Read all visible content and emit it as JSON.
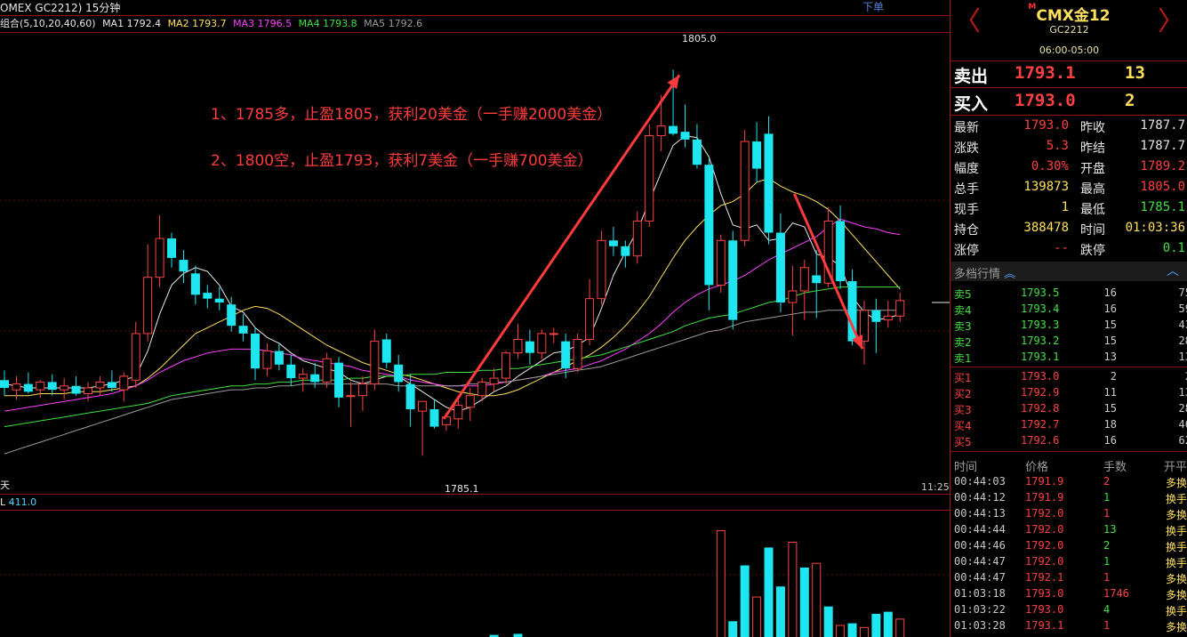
{
  "header": {
    "symbol": "OMEX GC2212) 15分钟",
    "order_button": "下单",
    "ma_group": "组合(5,10,20,40,60)",
    "ma": [
      {
        "label": "MA1 1792.4",
        "color": "#e8e8e8"
      },
      {
        "label": "MA2 1793.7",
        "color": "#ffe05a"
      },
      {
        "label": "MA3 1796.5",
        "color": "#ff40ff"
      },
      {
        "label": "MA4 1793.8",
        "color": "#40e040"
      },
      {
        "label": "MA5 1792.6",
        "color": "#9a9a9a"
      }
    ]
  },
  "annotations": {
    "line1": "1、1785多，止盈1805，获利20美金（一手赚2000美金）",
    "line2": "2、1800空，止盈1793，获利7美金（一手赚700美金）"
  },
  "chart_labels": {
    "high": "1805.0",
    "low": "1785.1",
    "left_marker": "天",
    "time_right": "11:25"
  },
  "volume_header": {
    "prefix": "L",
    "value": "411.0"
  },
  "chart_data": {
    "type": "candlestick",
    "ylim": [
      1783.6,
      1806.3
    ],
    "candles": [
      [
        1789.0,
        1789.5,
        1788.2,
        1788.6
      ],
      [
        1788.5,
        1789.2,
        1788.0,
        1788.8
      ],
      [
        1788.8,
        1789.4,
        1788.3,
        1788.4
      ],
      [
        1788.5,
        1789.0,
        1788.1,
        1788.9
      ],
      [
        1788.9,
        1789.3,
        1788.2,
        1788.5
      ],
      [
        1788.5,
        1789.1,
        1788.0,
        1788.7
      ],
      [
        1788.7,
        1789.2,
        1788.2,
        1788.3
      ],
      [
        1788.3,
        1788.9,
        1787.9,
        1788.6
      ],
      [
        1788.6,
        1789.2,
        1788.2,
        1788.9
      ],
      [
        1788.9,
        1789.5,
        1788.4,
        1788.6
      ],
      [
        1788.5,
        1789.4,
        1787.9,
        1789.2
      ],
      [
        1789.0,
        1792.0,
        1788.6,
        1791.4
      ],
      [
        1791.4,
        1796.0,
        1791.0,
        1794.3
      ],
      [
        1794.3,
        1797.5,
        1793.8,
        1796.3
      ],
      [
        1796.3,
        1796.6,
        1794.8,
        1795.3
      ],
      [
        1795.2,
        1795.7,
        1794.0,
        1794.6
      ],
      [
        1794.5,
        1794.9,
        1792.9,
        1793.4
      ],
      [
        1793.5,
        1793.9,
        1792.7,
        1793.2
      ],
      [
        1793.2,
        1793.8,
        1792.6,
        1793.0
      ],
      [
        1792.9,
        1793.3,
        1791.5,
        1791.8
      ],
      [
        1791.8,
        1792.4,
        1791.0,
        1791.4
      ],
      [
        1791.4,
        1791.7,
        1789.0,
        1789.6
      ],
      [
        1789.6,
        1790.9,
        1789.2,
        1790.5
      ],
      [
        1790.5,
        1790.9,
        1789.5,
        1789.8
      ],
      [
        1789.8,
        1790.3,
        1788.7,
        1789.1
      ],
      [
        1789.1,
        1789.6,
        1788.4,
        1789.3
      ],
      [
        1789.3,
        1789.9,
        1788.6,
        1788.9
      ],
      [
        1788.9,
        1790.4,
        1788.6,
        1790.1
      ],
      [
        1789.9,
        1790.2,
        1787.6,
        1788.1
      ],
      [
        1788.2,
        1788.9,
        1786.6,
        1788.2
      ],
      [
        1788.2,
        1789.2,
        1787.4,
        1788.8
      ],
      [
        1788.8,
        1791.6,
        1788.5,
        1791.0
      ],
      [
        1791.1,
        1791.4,
        1789.6,
        1789.9
      ],
      [
        1789.8,
        1790.3,
        1788.4,
        1788.9
      ],
      [
        1788.8,
        1789.3,
        1786.6,
        1787.5
      ],
      [
        1787.4,
        1787.9,
        1785.1,
        1787.9
      ],
      [
        1787.5,
        1788.0,
        1786.5,
        1786.6
      ],
      [
        1786.7,
        1787.3,
        1786.4,
        1787.1
      ],
      [
        1787.0,
        1788.0,
        1786.5,
        1787.7
      ],
      [
        1787.6,
        1788.6,
        1786.9,
        1788.2
      ],
      [
        1788.2,
        1789.1,
        1787.9,
        1788.9
      ],
      [
        1788.8,
        1789.6,
        1788.4,
        1789.1
      ],
      [
        1789.1,
        1790.5,
        1788.8,
        1790.4
      ],
      [
        1790.4,
        1791.9,
        1790.1,
        1791.1
      ],
      [
        1791.0,
        1791.6,
        1789.8,
        1790.4
      ],
      [
        1790.4,
        1791.6,
        1790.1,
        1791.4
      ],
      [
        1791.4,
        1791.7,
        1790.9,
        1791.4
      ],
      [
        1791.0,
        1791.4,
        1789.1,
        1789.6
      ],
      [
        1789.6,
        1791.4,
        1789.4,
        1791.1
      ],
      [
        1791.1,
        1794.2,
        1790.8,
        1793.2
      ],
      [
        1793.2,
        1796.7,
        1792.9,
        1796.2
      ],
      [
        1796.2,
        1796.9,
        1795.4,
        1795.9
      ],
      [
        1795.9,
        1796.2,
        1794.8,
        1795.4
      ],
      [
        1795.4,
        1797.7,
        1795.0,
        1797.2
      ],
      [
        1797.2,
        1802.2,
        1796.9,
        1801.6
      ],
      [
        1801.6,
        1803.7,
        1800.8,
        1802.1
      ],
      [
        1802.1,
        1805.0,
        1801.6,
        1801.7
      ],
      [
        1801.8,
        1803.2,
        1801.0,
        1801.4
      ],
      [
        1801.4,
        1802.2,
        1799.9,
        1800.1
      ],
      [
        1800.1,
        1800.4,
        1792.6,
        1793.9
      ],
      [
        1793.9,
        1796.5,
        1793.5,
        1796.2
      ],
      [
        1796.2,
        1796.7,
        1791.6,
        1792.1
      ],
      [
        1796.2,
        1801.9,
        1795.9,
        1801.3
      ],
      [
        1801.3,
        1802.3,
        1799.2,
        1799.9
      ],
      [
        1801.7,
        1802.6,
        1796.0,
        1796.6
      ],
      [
        1796.6,
        1797.6,
        1792.5,
        1793.0
      ],
      [
        1793.0,
        1794.9,
        1791.3,
        1793.6
      ],
      [
        1793.6,
        1795.2,
        1792.1,
        1794.8
      ],
      [
        1794.4,
        1795.7,
        1792.2,
        1794.0
      ],
      [
        1794.0,
        1797.9,
        1793.8,
        1797.2
      ],
      [
        1797.2,
        1798.0,
        1793.7,
        1794.1
      ],
      [
        1794.1,
        1794.7,
        1790.8,
        1791.0
      ],
      [
        1791.0,
        1793.1,
        1789.8,
        1792.6
      ],
      [
        1792.6,
        1793.2,
        1790.4,
        1792.0
      ],
      [
        1792.1,
        1793.1,
        1791.7,
        1792.3
      ],
      [
        1792.3,
        1793.5,
        1792.0,
        1793.1
      ]
    ],
    "ma_series": [
      {
        "name": "MA1",
        "color": "#e8e8e8",
        "values": [
          1788.8,
          1788.7,
          1788.6,
          1788.6,
          1788.6,
          1788.6,
          1788.6,
          1788.6,
          1788.7,
          1788.8,
          1789.0,
          1789.2,
          1790.5,
          1792.4,
          1793.9,
          1794.5,
          1794.8,
          1794.6,
          1793.9,
          1792.8,
          1792.5,
          1791.7,
          1791.2,
          1790.9,
          1790.4,
          1790.0,
          1789.8,
          1789.6,
          1789.4,
          1789.0,
          1788.8,
          1789.0,
          1789.2,
          1789.2,
          1788.8,
          1788.4,
          1788.0,
          1787.6,
          1787.4,
          1787.6,
          1788.0,
          1788.4,
          1788.7,
          1789.2,
          1789.6,
          1790.0,
          1790.4,
          1790.5,
          1790.8,
          1791.2,
          1792.7,
          1794.4,
          1795.6,
          1796.7,
          1798.2,
          1799.7,
          1801.1,
          1801.6,
          1801.5,
          1800.5,
          1798.6,
          1797.0,
          1796.8,
          1797.0,
          1796.2,
          1796.3,
          1797.1,
          1796.9,
          1795.5,
          1795.3,
          1794.9,
          1793.3,
          1792.5,
          1792.1,
          1792.2,
          1792.4
        ]
      },
      {
        "name": "MA2",
        "color": "#ffe05a",
        "values": [
          1788.2,
          1788.2,
          1788.2,
          1788.3,
          1788.3,
          1788.3,
          1788.4,
          1788.4,
          1788.4,
          1788.5,
          1788.6,
          1788.7,
          1789.1,
          1789.6,
          1790.2,
          1790.8,
          1791.4,
          1791.7,
          1792.0,
          1792.3,
          1792.6,
          1792.8,
          1792.7,
          1792.4,
          1792.0,
          1791.6,
          1791.2,
          1790.8,
          1790.5,
          1790.2,
          1789.9,
          1789.7,
          1789.5,
          1789.3,
          1789.2,
          1789.0,
          1788.8,
          1788.6,
          1788.4,
          1788.3,
          1788.2,
          1788.2,
          1788.3,
          1788.5,
          1788.8,
          1789.1,
          1789.4,
          1789.7,
          1790.0,
          1790.3,
          1790.7,
          1791.2,
          1791.8,
          1792.5,
          1793.3,
          1794.3,
          1795.3,
          1796.2,
          1796.9,
          1797.5,
          1798.0,
          1798.2,
          1798.6,
          1799.2,
          1799.4,
          1799.0,
          1798.7,
          1798.5,
          1798.2,
          1797.8,
          1797.2,
          1796.5,
          1795.8,
          1795.1,
          1794.4,
          1793.7
        ]
      },
      {
        "name": "MA3",
        "color": "#ff40ff",
        "values": [
          1787.4,
          1787.5,
          1787.6,
          1787.7,
          1787.8,
          1787.9,
          1788.0,
          1788.1,
          1788.2,
          1788.3,
          1788.5,
          1788.7,
          1789.0,
          1789.4,
          1789.7,
          1790.0,
          1790.2,
          1790.4,
          1790.5,
          1790.6,
          1790.6,
          1790.6,
          1790.5,
          1790.4,
          1790.3,
          1790.1,
          1790.0,
          1789.9,
          1789.8,
          1789.7,
          1789.5,
          1789.4,
          1789.3,
          1789.2,
          1789.0,
          1788.9,
          1788.8,
          1788.7,
          1788.7,
          1788.7,
          1788.7,
          1788.8,
          1788.9,
          1789.0,
          1789.1,
          1789.2,
          1789.4,
          1789.5,
          1789.6,
          1789.8,
          1790.0,
          1790.3,
          1790.6,
          1791.0,
          1791.4,
          1791.9,
          1792.5,
          1793.0,
          1793.4,
          1793.7,
          1793.9,
          1794.1,
          1794.4,
          1794.8,
          1795.2,
          1795.5,
          1795.8,
          1796.1,
          1796.4,
          1796.9,
          1797.3,
          1797.1,
          1796.9,
          1796.8,
          1796.6,
          1796.5
        ]
      },
      {
        "name": "MA4",
        "color": "#40e040",
        "values": [
          1786.6,
          1786.7,
          1786.8,
          1786.9,
          1787.0,
          1787.1,
          1787.2,
          1787.3,
          1787.4,
          1787.5,
          1787.6,
          1787.7,
          1787.8,
          1788.0,
          1788.2,
          1788.3,
          1788.4,
          1788.5,
          1788.6,
          1788.7,
          1788.7,
          1788.8,
          1788.8,
          1788.9,
          1788.9,
          1789.0,
          1789.0,
          1789.0,
          1789.0,
          1789.1,
          1789.1,
          1789.2,
          1789.2,
          1789.2,
          1789.3,
          1789.3,
          1789.3,
          1789.4,
          1789.4,
          1789.4,
          1789.5,
          1789.5,
          1789.6,
          1789.6,
          1789.7,
          1789.8,
          1789.9,
          1790.0,
          1790.1,
          1790.2,
          1790.3,
          1790.5,
          1790.7,
          1790.9,
          1791.1,
          1791.3,
          1791.5,
          1791.8,
          1792.0,
          1792.2,
          1792.3,
          1792.4,
          1792.6,
          1792.8,
          1793.0,
          1793.1,
          1793.3,
          1793.5,
          1793.6,
          1793.7,
          1793.8,
          1793.8,
          1793.8,
          1793.8,
          1793.8,
          1793.8
        ]
      },
      {
        "name": "MA5",
        "color": "#9a9a9a",
        "values": [
          1785.2,
          1785.4,
          1785.6,
          1785.8,
          1786.0,
          1786.2,
          1786.4,
          1786.6,
          1786.8,
          1787.0,
          1787.2,
          1787.4,
          1787.6,
          1787.8,
          1788.0,
          1788.1,
          1788.2,
          1788.3,
          1788.4,
          1788.5,
          1788.5,
          1788.6,
          1788.6,
          1788.7,
          1788.7,
          1788.8,
          1788.8,
          1788.8,
          1788.8,
          1788.8,
          1788.8,
          1788.8,
          1788.8,
          1788.7,
          1788.7,
          1788.7,
          1788.7,
          1788.7,
          1788.7,
          1788.8,
          1788.8,
          1788.9,
          1788.9,
          1789.0,
          1789.1,
          1789.2,
          1789.3,
          1789.4,
          1789.5,
          1789.6,
          1789.7,
          1789.9,
          1790.1,
          1790.3,
          1790.5,
          1790.7,
          1790.9,
          1791.1,
          1791.3,
          1791.5,
          1791.6,
          1791.8,
          1792.0,
          1792.1,
          1792.2,
          1792.3,
          1792.4,
          1792.5,
          1792.5,
          1792.6,
          1792.6,
          1792.6,
          1792.6,
          1792.6,
          1792.6,
          1792.6
        ]
      }
    ],
    "last_price_marker": 1793.0,
    "volume_ylim": [
      0,
      1200
    ],
    "volume_visible": [
      {
        "i": 41,
        "v": 20,
        "up": false
      },
      {
        "i": 43,
        "v": 30,
        "up": false
      },
      {
        "i": 60,
        "v": 1010,
        "up": true
      },
      {
        "i": 61,
        "v": 150,
        "up": false
      },
      {
        "i": 62,
        "v": 680,
        "up": false
      },
      {
        "i": 63,
        "v": 380,
        "up": true
      },
      {
        "i": 64,
        "v": 850,
        "up": false
      },
      {
        "i": 65,
        "v": 480,
        "up": false
      },
      {
        "i": 66,
        "v": 900,
        "up": true
      },
      {
        "i": 67,
        "v": 660,
        "up": false
      },
      {
        "i": 68,
        "v": 700,
        "up": true
      },
      {
        "i": 69,
        "v": 290,
        "up": false
      },
      {
        "i": 70,
        "v": 110,
        "up": true
      },
      {
        "i": 71,
        "v": 130,
        "up": false
      },
      {
        "i": 72,
        "v": 90,
        "up": true
      },
      {
        "i": 73,
        "v": 220,
        "up": false
      },
      {
        "i": 74,
        "v": 240,
        "up": false
      },
      {
        "i": 75,
        "v": 170,
        "up": true
      }
    ]
  },
  "panel": {
    "title": "CMX金12",
    "title_mark": "M",
    "code": "GC2212",
    "session": "06:00-05:00",
    "nav_prev": "〈",
    "nav_next": "〉",
    "sell": {
      "label": "卖出",
      "price": "1793.1",
      "qty": "13"
    },
    "buy": {
      "label": "买入",
      "price": "1793.0",
      "qty": "2"
    },
    "stats": [
      {
        "l1": "最新",
        "v1": "1793.0",
        "c1": "#ff4040",
        "l2": "昨收",
        "v2": "1787.7",
        "c2": "#e6e6e6"
      },
      {
        "l1": "涨跌",
        "v1": "5.3",
        "c1": "#ff4040",
        "l2": "昨结",
        "v2": "1787.7",
        "c2": "#e6e6e6"
      },
      {
        "l1": "幅度",
        "v1": "0.30%",
        "c1": "#ff4040",
        "l2": "开盘",
        "v2": "1789.2",
        "c2": "#ff4040"
      },
      {
        "l1": "总手",
        "v1": "139873",
        "c1": "#ffe05a",
        "l2": "最高",
        "v2": "1805.0",
        "c2": "#ff4040"
      },
      {
        "l1": "现手",
        "v1": "1",
        "c1": "#ffe05a",
        "l2": "最低",
        "v2": "1785.1",
        "c2": "#40e040"
      },
      {
        "l1": "持仓",
        "v1": "388478",
        "c1": "#ffe05a",
        "l2": "时间",
        "v2": "01:03:36",
        "c2": "#ffe05a"
      },
      {
        "l1": "涨停",
        "v1": "--",
        "c1": "#ff4040",
        "l2": "跌停",
        "v2": "0.1",
        "c2": "#40e040"
      }
    ],
    "depth_title": "多档行情",
    "depth_toggle": "︽",
    "depth_collapse": "︿",
    "asks": [
      {
        "l": "卖5",
        "p": "1793.5",
        "a": "16",
        "b": "75"
      },
      {
        "l": "卖4",
        "p": "1793.4",
        "a": "16",
        "b": "59"
      },
      {
        "l": "卖3",
        "p": "1793.3",
        "a": "15",
        "b": "43"
      },
      {
        "l": "卖2",
        "p": "1793.2",
        "a": "15",
        "b": "28"
      },
      {
        "l": "卖1",
        "p": "1793.1",
        "a": "13",
        "b": "13"
      }
    ],
    "bids": [
      {
        "l": "买1",
        "p": "1793.0",
        "a": "2",
        "b": "2"
      },
      {
        "l": "买2",
        "p": "1792.9",
        "a": "11",
        "b": "13"
      },
      {
        "l": "买3",
        "p": "1792.8",
        "a": "15",
        "b": "28"
      },
      {
        "l": "买4",
        "p": "1792.7",
        "a": "18",
        "b": "46"
      },
      {
        "l": "买5",
        "p": "1792.6",
        "a": "16",
        "b": "62"
      }
    ],
    "tick_headers": {
      "time": "时间",
      "price": "价格",
      "qty": "手数",
      "type": "开平"
    },
    "ticks": [
      {
        "t": "00:44:03",
        "p": "1791.9",
        "q": "2",
        "qc": "#ff4040",
        "k": "多换"
      },
      {
        "t": "00:44:12",
        "p": "1791.9",
        "q": "1",
        "qc": "#40e040",
        "k": "换手"
      },
      {
        "t": "00:44:13",
        "p": "1792.0",
        "q": "1",
        "qc": "#ff4040",
        "k": "多换"
      },
      {
        "t": "00:44:44",
        "p": "1792.0",
        "q": "13",
        "qc": "#40e040",
        "k": "换手"
      },
      {
        "t": "00:44:46",
        "p": "1792.0",
        "q": "2",
        "qc": "#40e040",
        "k": "换手"
      },
      {
        "t": "00:44:47",
        "p": "1792.0",
        "q": "1",
        "qc": "#40e040",
        "k": "换手"
      },
      {
        "t": "00:44:47",
        "p": "1792.1",
        "q": "1",
        "qc": "#ff4040",
        "k": "多换"
      },
      {
        "t": "01:03:18",
        "p": "1793.0",
        "q": "1746",
        "qc": "#ff4040",
        "k": "多换"
      },
      {
        "t": "01:03:22",
        "p": "1793.0",
        "q": "4",
        "qc": "#40e040",
        "k": "换手"
      },
      {
        "t": "01:03:28",
        "p": "1793.1",
        "q": "1",
        "qc": "#ff4040",
        "k": "多换"
      }
    ]
  },
  "colors": {
    "up": "#ff4444",
    "down": "#1ee6f0",
    "panel_border": "#a01616",
    "annot": "#ff3b3b"
  }
}
